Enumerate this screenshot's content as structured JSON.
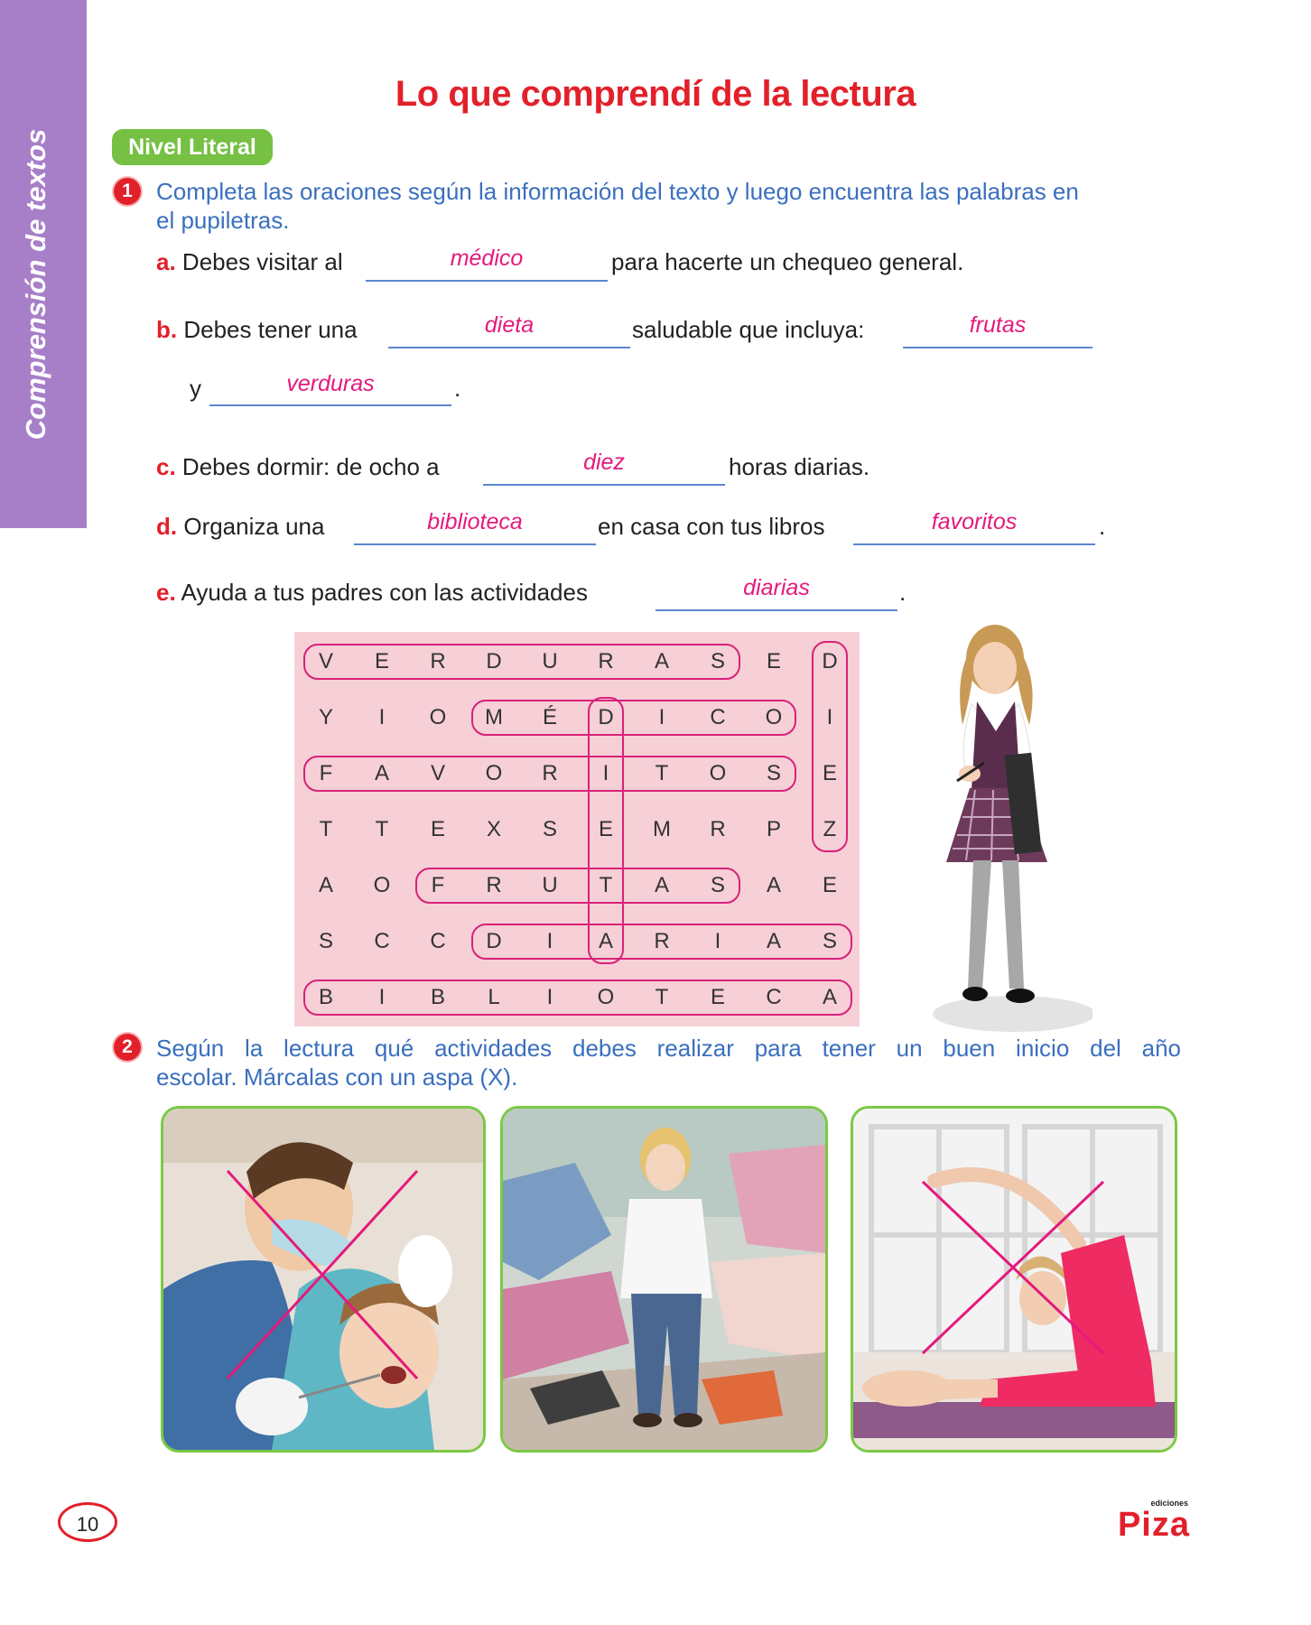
{
  "side_tab": {
    "label": "Comprensión de textos",
    "color": "#a77fc8"
  },
  "title": "Lo que comprendí de la lectura",
  "level_badge": "Nivel Literal",
  "question1": {
    "number": "1",
    "instruction_line1": "Completa las oraciones según la información del texto y luego encuentra las palabras en",
    "instruction_line2": "el pupiletras.",
    "items": {
      "a": {
        "letter": "a.",
        "before": "Debes visitar al",
        "answer": "médico",
        "after": "para hacerte un chequeo general."
      },
      "b": {
        "letter": "b.",
        "before": "Debes tener una",
        "answer1": "dieta",
        "middle": "saludable que incluya:",
        "answer2": "frutas",
        "cont": "y",
        "answer3": "verduras",
        "end": "."
      },
      "c": {
        "letter": "c.",
        "before": "Debes dormir: de ocho a",
        "answer": "diez",
        "after": "horas diarias."
      },
      "d": {
        "letter": "d.",
        "before": "Organiza una",
        "answer1": "biblioteca",
        "middle": "en casa con tus libros",
        "answer2": "favoritos",
        "end": "."
      },
      "e": {
        "letter": "e.",
        "before": "Ayuda a tus padres con las actividades",
        "answer": "diarias",
        "end": "."
      }
    }
  },
  "word_search": {
    "rows": [
      [
        "V",
        "E",
        "R",
        "D",
        "U",
        "R",
        "A",
        "S",
        "E",
        "D"
      ],
      [
        "Y",
        "I",
        "O",
        "M",
        "É",
        "D",
        "I",
        "C",
        "O",
        "I"
      ],
      [
        "F",
        "A",
        "V",
        "O",
        "R",
        "I",
        "T",
        "O",
        "S",
        "E"
      ],
      [
        "T",
        "T",
        "E",
        "X",
        "S",
        "E",
        "M",
        "R",
        "P",
        "Z"
      ],
      [
        "A",
        "O",
        "F",
        "R",
        "U",
        "T",
        "A",
        "S",
        "A",
        "E"
      ],
      [
        "S",
        "C",
        "C",
        "D",
        "I",
        "A",
        "R",
        "I",
        "A",
        "S"
      ],
      [
        "B",
        "I",
        "B",
        "L",
        "I",
        "O",
        "T",
        "E",
        "C",
        "A"
      ]
    ],
    "found_words": [
      "VERDURAS",
      "MÉDICO",
      "FAVORITOS",
      "DIEZ",
      "DIETA",
      "FRUTAS",
      "DIARIAS",
      "BIBLIOTECA"
    ],
    "background": "#f7cfd6",
    "loop_color": "#d8217a"
  },
  "question2": {
    "number": "2",
    "instruction_line1": "Según la lectura qué actividades debes realizar para tener un buen inicio del año",
    "instruction_line2": "escolar. Márcalas con un aspa (X).",
    "images": [
      {
        "name": "dentist-checkup",
        "marked": true
      },
      {
        "name": "messy-room",
        "marked": false
      },
      {
        "name": "stretching-exercise",
        "marked": true
      }
    ]
  },
  "footer": {
    "page_number": "10",
    "brand_small": "ediciones",
    "brand": "Piza"
  }
}
